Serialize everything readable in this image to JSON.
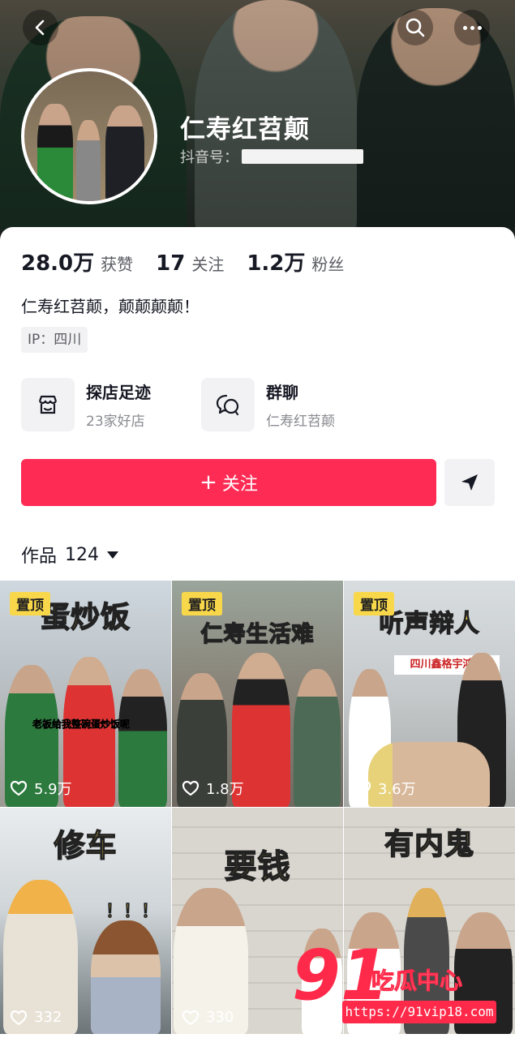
{
  "profile": {
    "name": "仁寿红苕颠",
    "id_label": "抖音号：",
    "bio": "仁寿红苕颠，颠颠颠颠！",
    "ip": "IP：四川"
  },
  "stats": [
    {
      "num": "28.0万",
      "label": "获赞"
    },
    {
      "num": "17",
      "label": "关注"
    },
    {
      "num": "1.2万",
      "label": "粉丝"
    }
  ],
  "services": [
    {
      "icon": "store-icon",
      "title": "探店足迹",
      "subtitle": "23家好店"
    },
    {
      "icon": "group-chat-icon",
      "title": "群聊",
      "subtitle": "仁寿红苕颠"
    }
  ],
  "actions": {
    "follow_label": "关注",
    "follow_color": "#fe2c55"
  },
  "works": {
    "label": "作品",
    "count": "124"
  },
  "videos": [
    {
      "title": "蛋炒饭",
      "pinned": "置顶",
      "likes": "5.9万",
      "caption": "老板给我整碗蛋炒饭呢"
    },
    {
      "title": "仁寿生活难",
      "pinned": "置顶",
      "likes": "1.8万"
    },
    {
      "title": "听声辩人",
      "pinned": "置顶",
      "likes": "3.6万",
      "sign": "四川鑫格宇鸿商"
    },
    {
      "title": "修车",
      "pinned": "",
      "likes": "332",
      "exclaim": "！！！"
    },
    {
      "title": "要钱",
      "pinned": "",
      "likes": "330"
    },
    {
      "title": "有内鬼",
      "pinned": "",
      "likes": ""
    }
  ],
  "watermark": {
    "number": "91",
    "text": "吃瓜中心",
    "url": "https://91vip18.com"
  }
}
